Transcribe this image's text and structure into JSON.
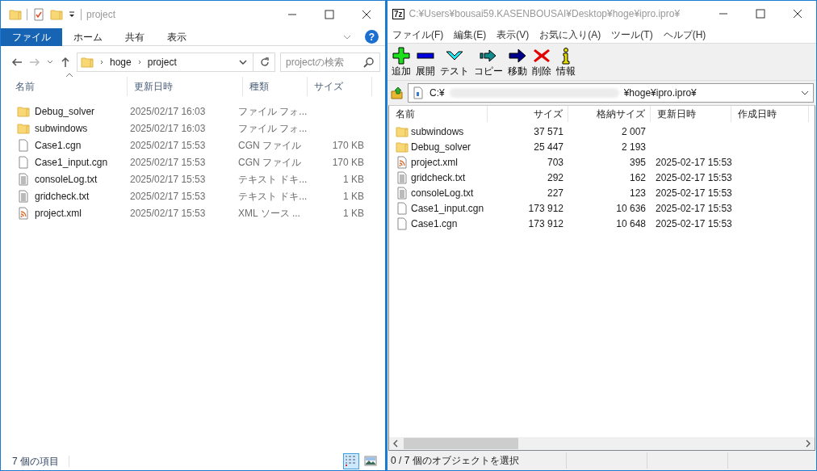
{
  "explorer": {
    "title": "project",
    "ribbon_tabs": [
      {
        "label": "ファイル",
        "selected": true
      },
      {
        "label": "ホーム",
        "selected": false
      },
      {
        "label": "共有",
        "selected": false
      },
      {
        "label": "表示",
        "selected": false
      }
    ],
    "help_glyph": "?",
    "breadcrumb": [
      "hoge",
      "project"
    ],
    "search": {
      "placeholder": "projectの検索"
    },
    "columns": [
      "名前",
      "更新日時",
      "種類",
      "サイズ"
    ],
    "rows": [
      {
        "kind": "folder",
        "name": "Debug_solver",
        "modified": "2025/02/17 16:03",
        "type": "ファイル フォ...",
        "size": ""
      },
      {
        "kind": "folder",
        "name": "subwindows",
        "modified": "2025/02/17 16:03",
        "type": "ファイル フォ...",
        "size": ""
      },
      {
        "kind": "file",
        "name": "Case1.cgn",
        "modified": "2025/02/17 15:53",
        "type": "CGN ファイル",
        "size": "170 KB"
      },
      {
        "kind": "file",
        "name": "Case1_input.cgn",
        "modified": "2025/02/17 15:53",
        "type": "CGN ファイル",
        "size": "170 KB"
      },
      {
        "kind": "text",
        "name": "consoleLog.txt",
        "modified": "2025/02/17 15:53",
        "type": "テキスト ドキ...",
        "size": "1 KB"
      },
      {
        "kind": "text",
        "name": "gridcheck.txt",
        "modified": "2025/02/17 15:53",
        "type": "テキスト ドキ...",
        "size": "1 KB"
      },
      {
        "kind": "xml",
        "name": "project.xml",
        "modified": "2025/02/17 15:53",
        "type": "XML ソース ...",
        "size": "1 KB"
      }
    ],
    "status": "7 個の項目",
    "views": [
      {
        "kind": "details",
        "selected": true
      },
      {
        "kind": "large",
        "selected": false
      }
    ]
  },
  "archiver": {
    "logo": "7z",
    "title": "C:¥Users¥bousai59.KASENBOUSAI¥Desktop¥hoge¥ipro.ipro¥",
    "menu": [
      "ファイル(F)",
      "編集(E)",
      "表示(V)",
      "お気に入り(A)",
      "ツール(T)",
      "ヘルプ(H)"
    ],
    "toolbar": [
      {
        "kind": "add",
        "label": "追加"
      },
      {
        "kind": "extract",
        "label": "展開"
      },
      {
        "kind": "test",
        "label": "テスト"
      },
      {
        "kind": "copy",
        "label": "コピー"
      },
      {
        "kind": "move",
        "label": "移動"
      },
      {
        "kind": "delete",
        "label": "削除"
      },
      {
        "kind": "info",
        "label": "情報"
      }
    ],
    "path_start": "C:¥",
    "path_end": "¥hoge¥ipro.ipro¥",
    "columns": [
      "名前",
      "サイズ",
      "格納サイズ",
      "更新日時",
      "作成日時"
    ],
    "rows": [
      {
        "kind": "folder",
        "name": "subwindows",
        "size": "37 571",
        "packed": "2 007",
        "modified": ""
      },
      {
        "kind": "folder",
        "name": "Debug_solver",
        "size": "25 447",
        "packed": "2 193",
        "modified": ""
      },
      {
        "kind": "xml",
        "name": "project.xml",
        "size": "703",
        "packed": "395",
        "modified": "2025-02-17 15:53"
      },
      {
        "kind": "text",
        "name": "gridcheck.txt",
        "size": "292",
        "packed": "162",
        "modified": "2025-02-17 15:53"
      },
      {
        "kind": "text",
        "name": "consoleLog.txt",
        "size": "227",
        "packed": "123",
        "modified": "2025-02-17 15:53"
      },
      {
        "kind": "file",
        "name": "Case1_input.cgn",
        "size": "173 912",
        "packed": "10 636",
        "modified": "2025-02-17 15:53"
      },
      {
        "kind": "file",
        "name": "Case1.cgn",
        "size": "173 912",
        "packed": "10 648",
        "modified": "2025-02-17 15:53"
      }
    ],
    "status": "0 / 7 個のオブジェクトを選択"
  }
}
